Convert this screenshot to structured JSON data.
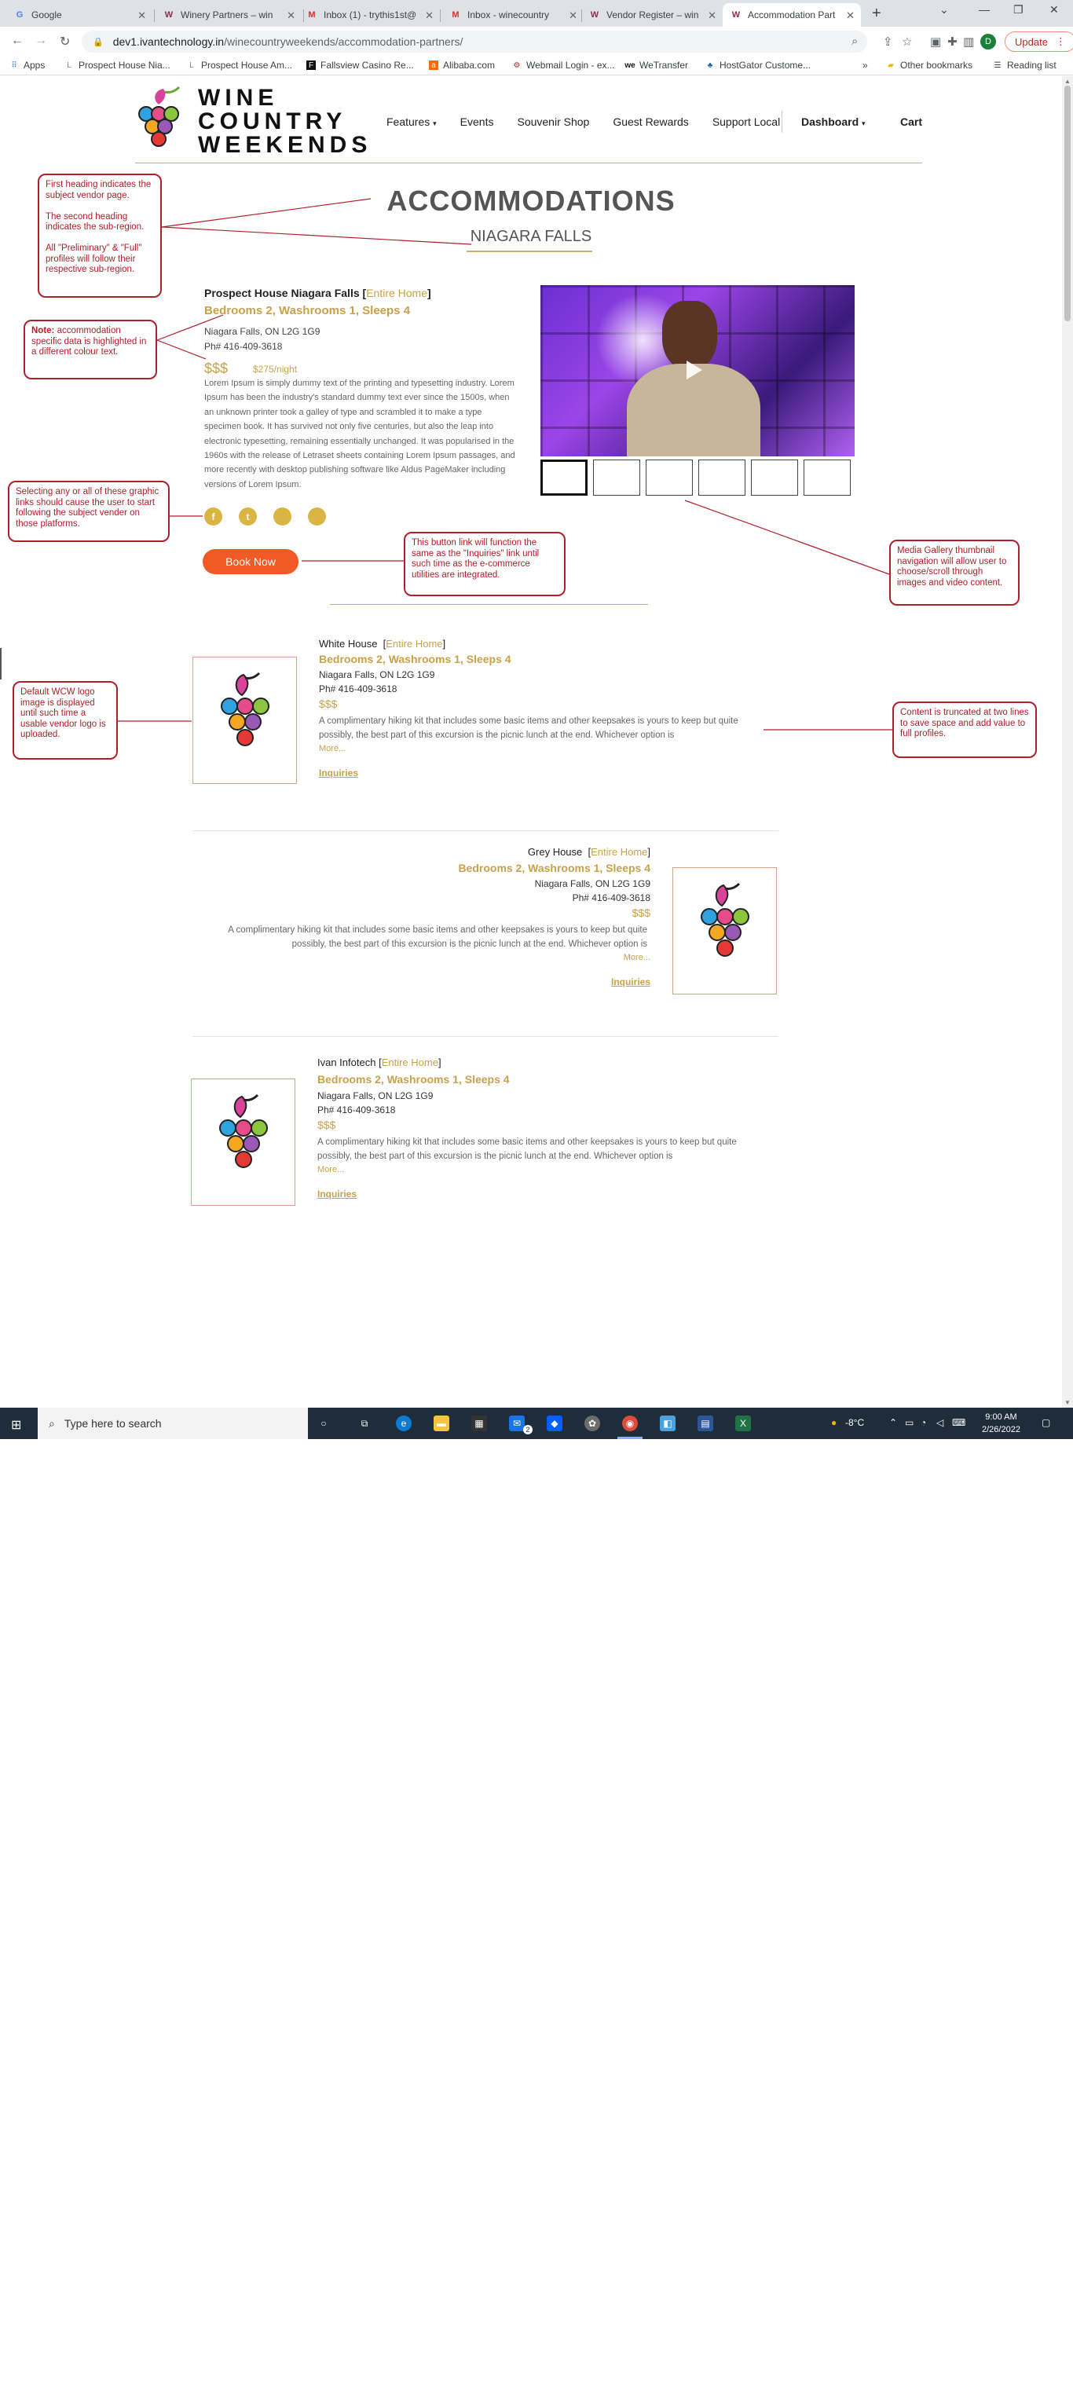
{
  "browser": {
    "tabs": [
      {
        "title": "Google",
        "favicon": "G"
      },
      {
        "title": "Winery Partners – win",
        "favicon": "W"
      },
      {
        "title": "Inbox (1) - trythis1st@",
        "favicon": "M"
      },
      {
        "title": "Inbox - winecountry",
        "favicon": "M"
      },
      {
        "title": "Vendor Register – win",
        "favicon": "W"
      },
      {
        "title": "Accommodation Part",
        "favicon": "W"
      }
    ],
    "url_host": "dev1.ivantechnology.in",
    "url_path": "/winecountryweekends/accommodation-partners/",
    "profile_initial": "D",
    "update_label": "Update",
    "bookmarks": [
      "Apps",
      "Prospect House Nia...",
      "Prospect House Am...",
      "Fallsview Casino Re...",
      "Alibaba.com",
      "Webmail Login - ex...",
      "WeTransfer",
      "HostGator Custome..."
    ],
    "other_bookmarks": "Other bookmarks",
    "reading_list": "Reading list"
  },
  "site": {
    "logo_line1": "WINE",
    "logo_line2": "COUNTRY",
    "logo_line3": "WEEKENDS",
    "nav": [
      "Features",
      "Events",
      "Souvenir Shop",
      "Guest Rewards",
      "Support Local"
    ],
    "dashboard": "Dashboard",
    "cart": "Cart"
  },
  "page": {
    "heading": "ACCOMMODATIONS",
    "subheading": "NIAGARA FALLS"
  },
  "featured": {
    "name": "Prospect House Niagara Falls",
    "type": "Entire Home",
    "rooms": "Bedrooms 2, Washrooms 1, Sleeps 4",
    "address": "Niagara Falls, ON L2G 1G9",
    "phone": "Ph# 416-409-3618",
    "price_level": "$$$",
    "rate": "$275/night",
    "description": "Lorem Ipsum is simply dummy text of the printing and typesetting industry. Lorem Ipsum has been the industry's standard dummy text ever since the 1500s, when an unknown printer took a galley of type and scrambled it to make a type specimen book. It has survived not only five centuries, but also the leap into electronic typesetting, remaining essentially unchanged. It was popularised in the 1960s with the release of Letraset sheets containing Lorem Ipsum passages, and more recently with desktop publishing software like Aldus PageMaker including versions of Lorem Ipsum.",
    "social": [
      "facebook",
      "twitter",
      "",
      ""
    ],
    "book_now": "Book Now"
  },
  "listings": [
    {
      "name": "White House",
      "type": "Entire Home",
      "rooms": "Bedrooms 2, Washrooms 1, Sleeps 4",
      "address": "Niagara Falls, ON L2G 1G9",
      "phone": "Ph# 416-409-3618",
      "price_level": "$$$",
      "description": "A complimentary hiking kit that includes some basic items and other keepsakes is yours to keep but quite possibly, the best part of this excursion is the picnic lunch at the end. Whichever option is",
      "more": "More...",
      "inquiries": "Inquiries"
    },
    {
      "name": "Grey House",
      "type": "Entire Home",
      "rooms": "Bedrooms 2, Washrooms 1, Sleeps 4",
      "address": "Niagara Falls, ON L2G 1G9",
      "phone": "Ph# 416-409-3618",
      "price_level": "$$$",
      "description": "A complimentary hiking kit that includes some basic items and other keepsakes is yours to keep but quite possibly, the best part of this excursion is the picnic lunch at the end. Whichever option is",
      "more": "More...",
      "inquiries": "Inquiries"
    },
    {
      "name": "Ivan Infotech",
      "type": "Entire Home",
      "rooms": "Bedrooms 2, Washrooms 1, Sleeps 4",
      "address": "Niagara Falls, ON L2G 1G9",
      "phone": "Ph# 416-409-3618",
      "price_level": "$$$",
      "description": "A complimentary hiking kit that includes some basic items and other keepsakes is yours to keep but quite possibly, the best part of this excursion is the picnic lunch at the end. Whichever option is",
      "more": "More...",
      "inquiries": "Inquiries"
    }
  ],
  "annotations": {
    "headings_1": "First heading indicates the subject vendor page.",
    "headings_2": "The second heading indicates the sub-region.",
    "headings_3": "All \"Preliminary\" & \"Full\" profiles will follow their respective sub-region.",
    "note_label": "Note:",
    "note_text": "accommodation specific data is highlighted in a different colour text.",
    "social": "Selecting any or all of these graphic links should cause the user to start following the subject vender on those platforms.",
    "book_button": "This button link will function the same as the \"Inquiries\" link until such time as the e-commerce utilities are integrated.",
    "media": "Media Gallery thumbnail navigation will allow user to choose/scroll through images and video content.",
    "default_logo": "Default WCW logo image is displayed until such time a usable vendor logo is uploaded.",
    "truncated": "Content is truncated at two lines to save space and add value to full profiles."
  },
  "taskbar": {
    "search_placeholder": "Type here to search",
    "weather": "-8°C",
    "time": "9:00 AM",
    "date": "2/26/2022",
    "mail_badge": "2"
  }
}
